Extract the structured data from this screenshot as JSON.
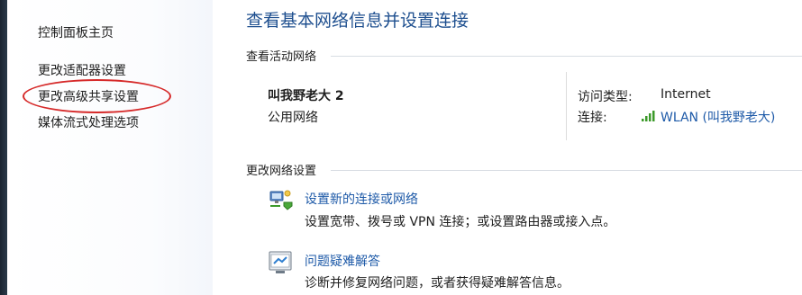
{
  "sidebar": {
    "items": [
      {
        "label": "控制面板主页"
      },
      {
        "label": "更改适配器设置"
      },
      {
        "label": "更改高级共享设置"
      },
      {
        "label": "媒体流式处理选项"
      }
    ]
  },
  "main": {
    "title": "查看基本网络信息并设置连接",
    "active_networks": {
      "header": "查看活动网络",
      "network_name": "叫我野老大 2",
      "network_category": "公用网络",
      "access_type_label": "访问类型:",
      "access_type_value": "Internet",
      "connections_label": "连接:",
      "connection_value": "WLAN (叫我野老大)"
    },
    "change_settings": {
      "header": "更改网络设置",
      "tasks": [
        {
          "title": "设置新的连接或网络",
          "description": "设置宽带、拨号或 VPN 连接；或设置路由器或接入点。",
          "icon": "network-setup-icon"
        },
        {
          "title": "问题疑难解答",
          "description": "诊断并修复网络问题，或者获得疑难解答信息。",
          "icon": "troubleshoot-icon"
        }
      ]
    }
  },
  "colors": {
    "title_blue": "#1e4f8f",
    "link_blue": "#1e5aa8",
    "highlight_red": "#d62a2a",
    "wifi_green": "#3c9a2a"
  }
}
